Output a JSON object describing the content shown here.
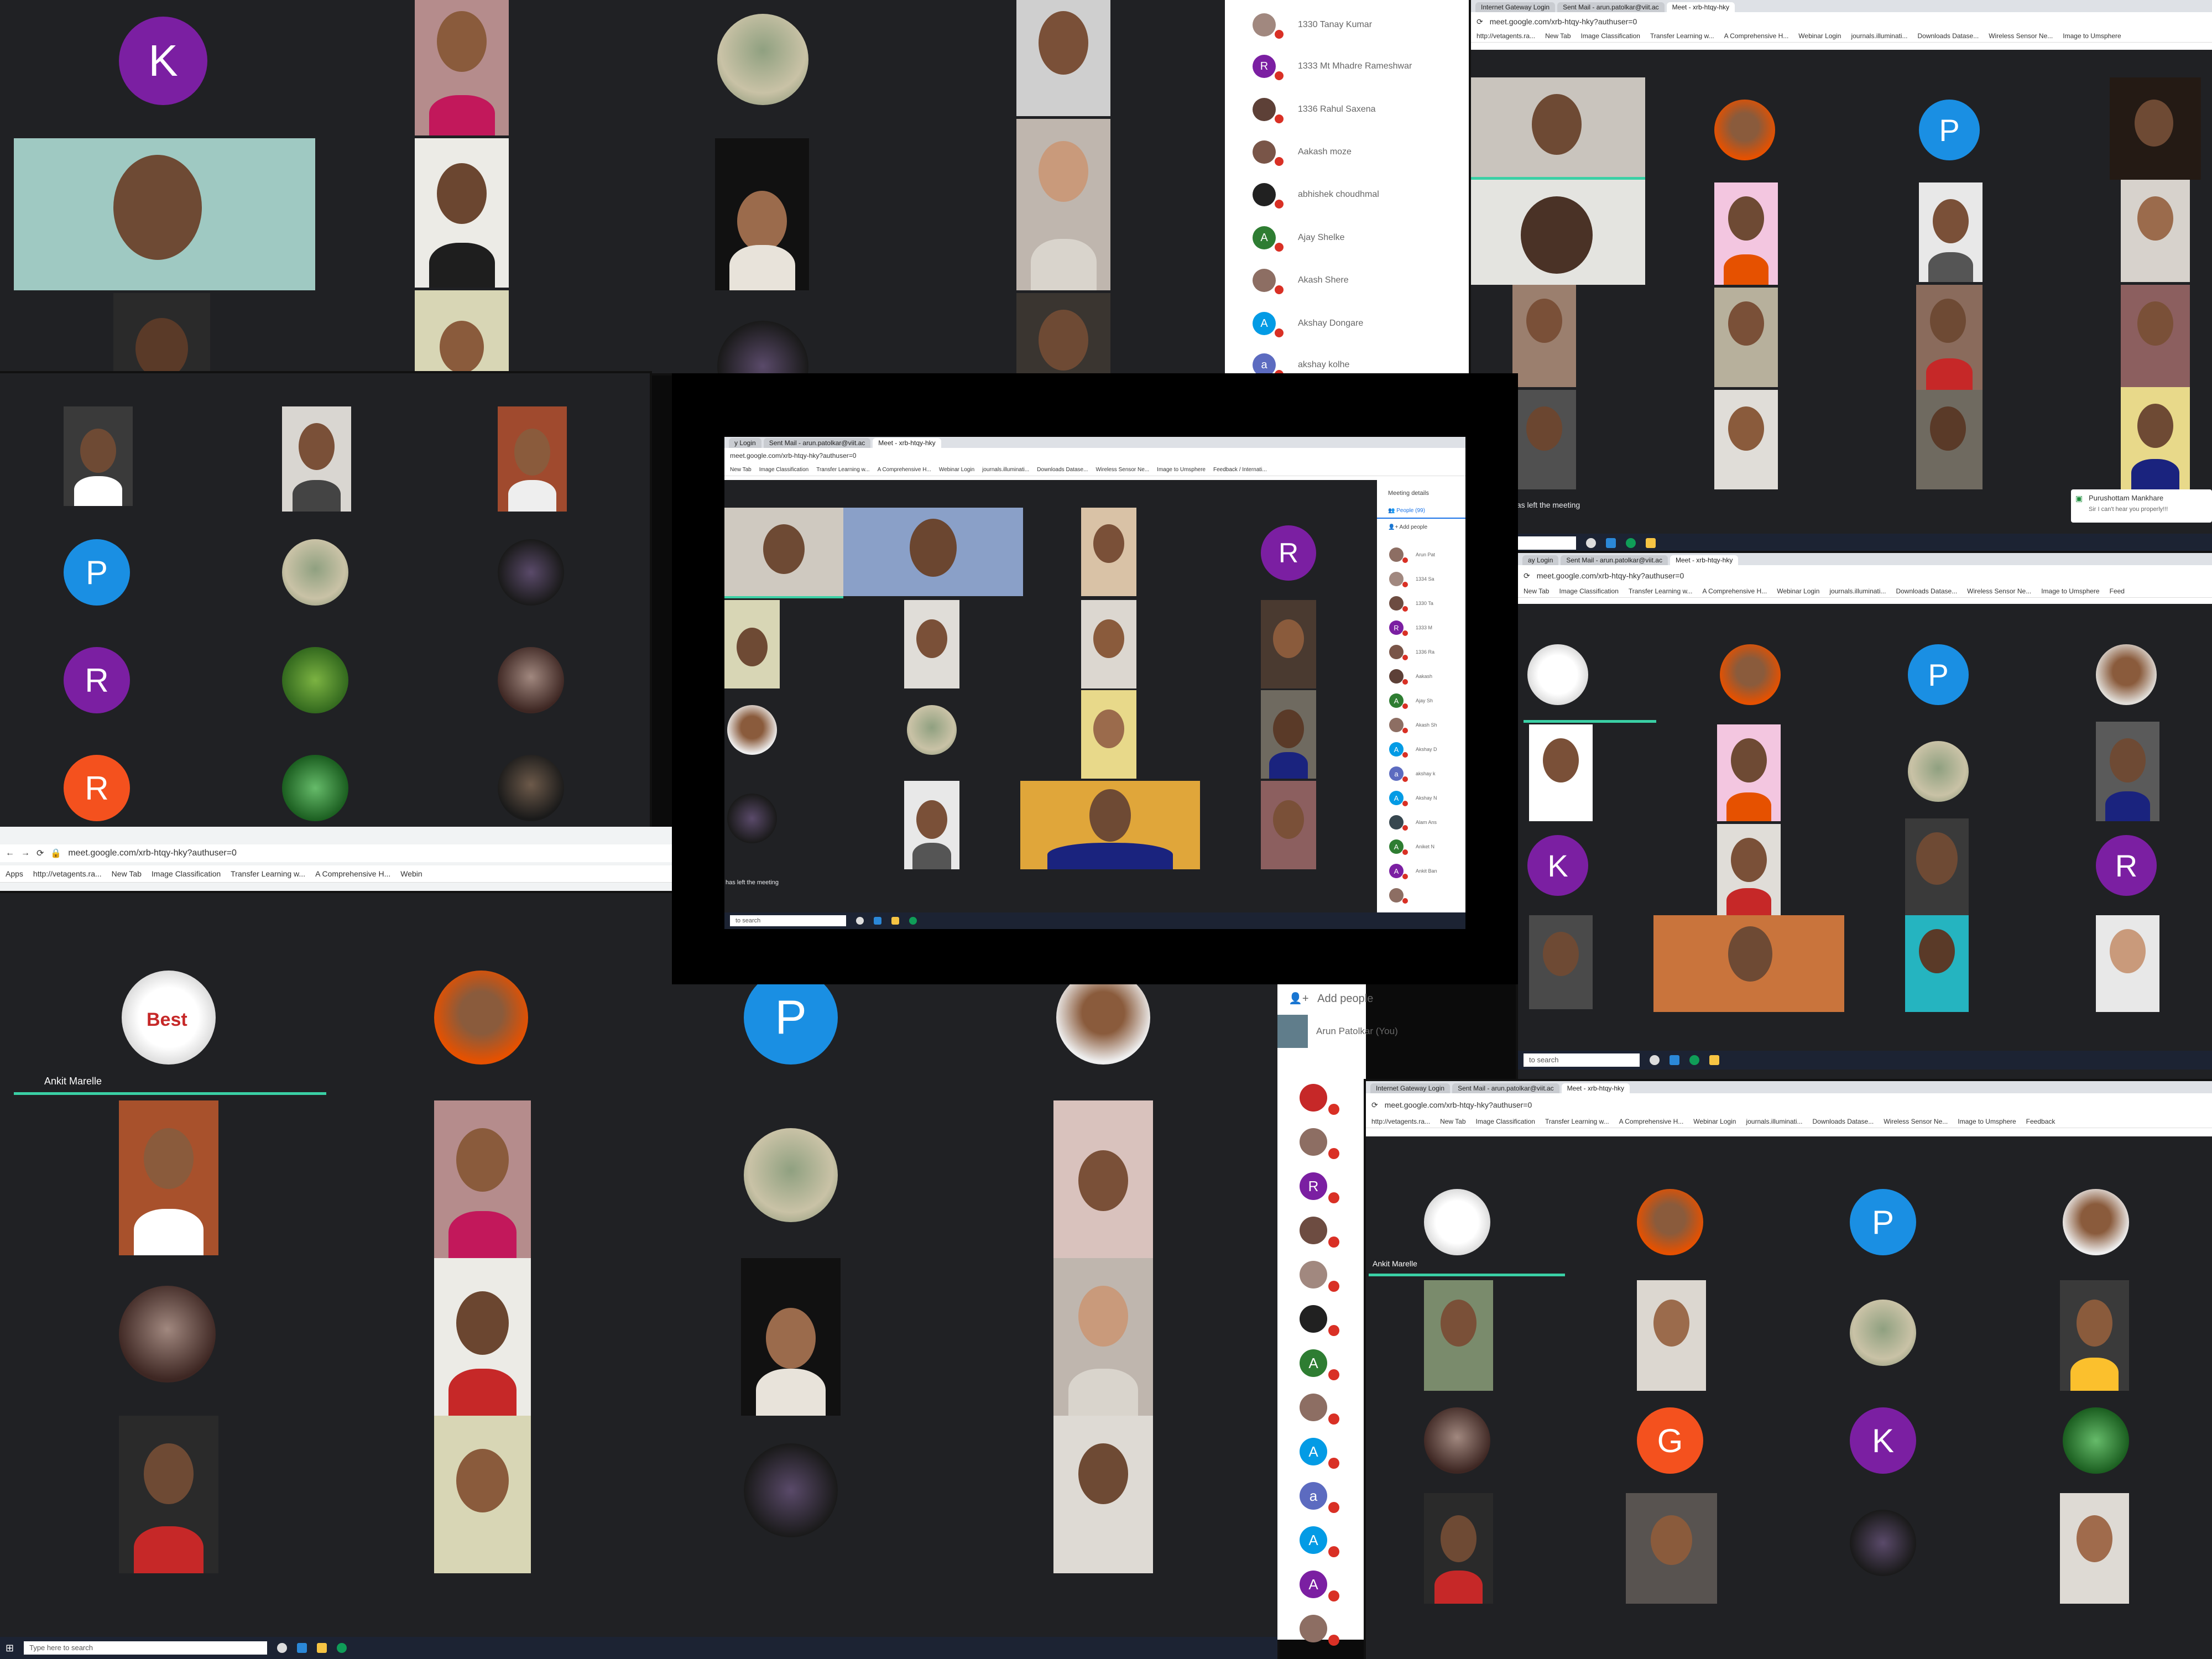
{
  "colors": {
    "accent_blue": "#1a8fe3",
    "accent_purple": "#7b1fa2",
    "accent_orange": "#f4511e",
    "accent_green": "#2e7d32",
    "speaker_bar": "#3ad0a5",
    "meet_bg": "#202124"
  },
  "panel_a": {
    "avatars": [
      {
        "letter": "K",
        "color": "#7b1fa2"
      }
    ]
  },
  "panel_c": {
    "avatars": [
      {
        "letter": "P",
        "color": "#1a8fe3"
      },
      {
        "letter": "R",
        "color": "#7b1fa2"
      },
      {
        "letter": "R",
        "color": "#f4511e"
      }
    ]
  },
  "center": {
    "tabs": [
      "y Login",
      "Sent Mail - arun.patolkar@viit.ac",
      "Meet - xrb-htqy-hky"
    ],
    "url": "meet.google.com/xrb-htqy-hky?authuser=0",
    "bookmarks": [
      "New Tab",
      "Image Classification",
      "Transfer Learning w...",
      "A Comprehensive H...",
      "Webinar Login",
      "journals.illuminati...",
      "Downloads Datase...",
      "Wireless Sensor Ne...",
      "Image to Umsphere",
      "Feedback / Internati..."
    ],
    "avatar_letter": "R",
    "meeting_details": "Meeting details",
    "people_tab": "People (99)",
    "add_people": "Add people",
    "toast": "has left the meeting",
    "search": "to search",
    "people": [
      {
        "name": "Arun Pat",
        "initial": "",
        "color": "#8d6e63"
      },
      {
        "name": "1334 Sa",
        "initial": "",
        "color": "#a1887f"
      },
      {
        "name": "1330 Ta",
        "initial": "",
        "color": "#6d4c41"
      },
      {
        "name": "1333 M",
        "initial": "R",
        "color": "#7b1fa2"
      },
      {
        "name": "1336 Ra",
        "initial": "",
        "color": "#795548"
      },
      {
        "name": "Aakash",
        "initial": "",
        "color": "#5d4037"
      },
      {
        "name": "Ajay Sh",
        "initial": "A",
        "color": "#2e7d32"
      },
      {
        "name": "Akash Sh",
        "initial": "",
        "color": "#8d6e63"
      },
      {
        "name": "Akshay D",
        "initial": "A",
        "color": "#039be5"
      },
      {
        "name": "akshay k",
        "initial": "a",
        "color": "#5c6bc0"
      },
      {
        "name": "Akshay N",
        "initial": "A",
        "color": "#039be5"
      },
      {
        "name": "Alam Ans",
        "initial": "",
        "color": "#37474f"
      },
      {
        "name": "Aniket N",
        "initial": "A",
        "color": "#2e7d32"
      },
      {
        "name": "Ankit Ban",
        "initial": "A",
        "color": "#7b1fa2"
      },
      {
        "name": "",
        "initial": "",
        "color": "#8d6e63"
      }
    ]
  },
  "people_top": {
    "rows": [
      {
        "name": "1330 Tanay Kumar",
        "initial": "",
        "color": "#a1887f"
      },
      {
        "name": "1333 Mt Mhadre Rameshwar",
        "initial": "R",
        "color": "#7b1fa2"
      },
      {
        "name": "1336 Rahul Saxena",
        "initial": "",
        "color": "#5d4037"
      },
      {
        "name": "Aakash moze",
        "initial": "",
        "color": "#795548"
      },
      {
        "name": "abhishek choudhmal",
        "initial": "",
        "color": "#212121"
      },
      {
        "name": "Ajay Shelke",
        "initial": "A",
        "color": "#2e7d32"
      },
      {
        "name": "Akash Shere",
        "initial": "",
        "color": "#8d6e63"
      },
      {
        "name": "Akshay Dongare",
        "initial": "A",
        "color": "#039be5"
      },
      {
        "name": "akshay kolhe",
        "initial": "a",
        "color": "#5c6bc0"
      }
    ]
  },
  "panel_b": {
    "avatars": [
      {
        "letter": "P",
        "color": "#1a8fe3"
      }
    ],
    "toast": "has left the meeting",
    "chat_name": "Purushottam Mankhare",
    "chat_msg": "Sir I can't hear you properly!!!",
    "search": "search"
  },
  "panel_d": {
    "tabs": [
      "ay Login",
      "Sent Mail - arun.patolkar@viit.ac",
      "Meet - xrb-htqy-hky"
    ],
    "url": "meet.google.com/xrb-htqy-hky?authuser=0",
    "bookmarks": [
      "New Tab",
      "Image Classification",
      "Transfer Learning w...",
      "A Comprehensive H...",
      "Webinar Login",
      "journals.illuminati...",
      "Downloads Datase...",
      "Wireless Sensor Ne...",
      "Image to Umsphere",
      "Feed"
    ],
    "avatars": [
      {
        "letter": "P",
        "color": "#1a8fe3"
      },
      {
        "letter": "K",
        "color": "#7b1fa2"
      },
      {
        "letter": "R",
        "color": "#7b1fa2"
      }
    ],
    "search": "to search"
  },
  "mid_chrome": {
    "url": "meet.google.com/xrb-htqy-hky?authuser=0",
    "bookmarks": [
      "Apps",
      "http://vetagents.ra...",
      "New Tab",
      "Image Classification",
      "Transfer Learning w...",
      "A Comprehensive H...",
      "Webin"
    ]
  },
  "panel_e": {
    "speaker": "Ankit Marelle",
    "best": "Best",
    "avatars": [
      {
        "letter": "P",
        "color": "#1a8fe3"
      }
    ],
    "add_people": "Add people",
    "you": "Arun Patolkar (You)",
    "search": "Type here to search",
    "list": [
      {
        "initial": "",
        "color": "#c62828"
      },
      {
        "initial": "",
        "color": "#8d6e63"
      },
      {
        "initial": "R",
        "color": "#7b1fa2"
      },
      {
        "initial": "",
        "color": "#6d4c41"
      },
      {
        "initial": "",
        "color": "#a1887f"
      },
      {
        "initial": "",
        "color": "#212121"
      },
      {
        "initial": "A",
        "color": "#2e7d32"
      },
      {
        "initial": "",
        "color": "#8d6e63"
      },
      {
        "initial": "A",
        "color": "#039be5"
      },
      {
        "initial": "a",
        "color": "#5c6bc0"
      },
      {
        "initial": "A",
        "color": "#039be5"
      },
      {
        "initial": "A",
        "color": "#7b1fa2"
      },
      {
        "initial": "",
        "color": "#8d6e63"
      }
    ]
  },
  "panel_f": {
    "tabs": [
      "Internet Gateway Login",
      "Sent Mail - arun.patolkar@viit.ac",
      "Meet - xrb-htqy-hky"
    ],
    "url": "meet.google.com/xrb-htqy-hky?authuser=0",
    "bookmarks": [
      "http://vetagents.ra...",
      "New Tab",
      "Image Classification",
      "Transfer Learning w...",
      "A Comprehensive H...",
      "Webinar Login",
      "journals.illuminati...",
      "Downloads Datase...",
      "Wireless Sensor Ne...",
      "Image to Umsphere",
      "Feedback"
    ],
    "speaker": "Ankit Marelle",
    "avatars": [
      {
        "letter": "P",
        "color": "#1a8fe3"
      },
      {
        "letter": "G",
        "color": "#f4511e"
      },
      {
        "letter": "K",
        "color": "#7b1fa2"
      }
    ]
  },
  "top_right_chrome": {
    "tabs": [
      "Internet Gateway Login",
      "Sent Mail - arun.patolkar@viit.ac",
      "Meet - xrb-htqy-hky"
    ],
    "url": "meet.google.com/xrb-htqy-hky?authuser=0",
    "bookmarks": [
      "http://vetagents.ra...",
      "New Tab",
      "Image Classification",
      "Transfer Learning w...",
      "A Comprehensive H...",
      "Webinar Login",
      "journals.illuminati...",
      "Downloads Datase...",
      "Wireless Sensor Ne...",
      "Image to Umsphere"
    ]
  }
}
